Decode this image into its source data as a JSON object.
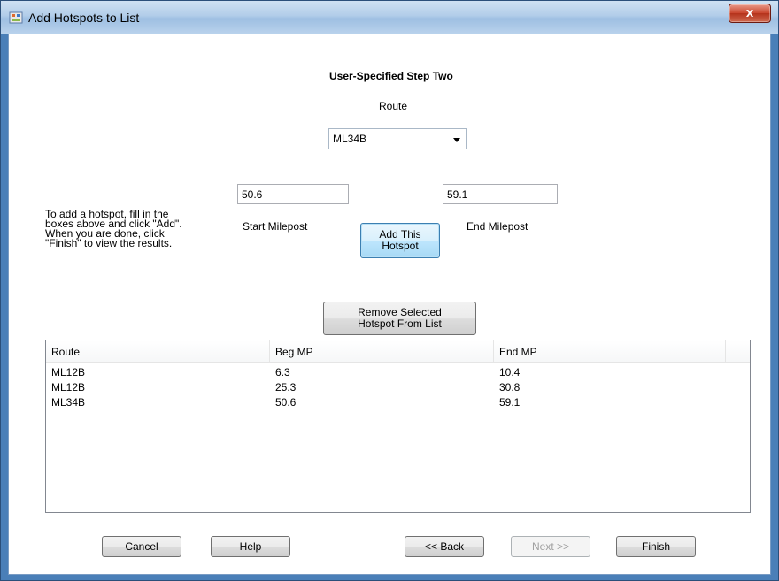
{
  "window": {
    "title": "Add Hotspots to List",
    "close_label": "x"
  },
  "step": {
    "heading": "User-Specified Step Two",
    "route_label": "Route",
    "route_value": "ML34B"
  },
  "inputs": {
    "start_value": "50.6",
    "start_label": "Start Milepost",
    "end_value": "59.1",
    "end_label": "End Milepost"
  },
  "instructions": "To add a hotspot, fill in the\nboxes above and click \"Add\".\nWhen you are done, click\n\"Finish\" to view the results.",
  "buttons": {
    "add": "Add This\nHotspot",
    "remove": "Remove Selected\nHotspot From List",
    "cancel": "Cancel",
    "help": "Help",
    "back": "<< Back",
    "next": "Next >>",
    "finish": "Finish"
  },
  "list": {
    "columns": [
      "Route",
      "Beg MP",
      "End MP"
    ],
    "rows": [
      [
        "ML12B",
        "6.3",
        "10.4"
      ],
      [
        "ML12B",
        "25.3",
        "30.8"
      ],
      [
        "ML34B",
        "50.6",
        "59.1"
      ]
    ]
  }
}
